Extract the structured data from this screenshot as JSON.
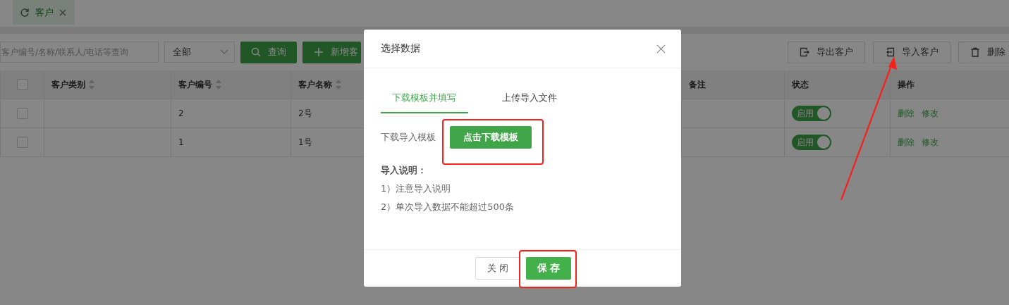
{
  "tab": {
    "label": "客户",
    "selected": true
  },
  "toolbar": {
    "search": {
      "placeholder": "客户编号/名称/联系人/电话等查询"
    },
    "filter": {
      "value": "全部"
    },
    "query_button": "查询",
    "add_button": "新增客",
    "actions": [
      {
        "kind": "export",
        "label": "导出客户"
      },
      {
        "kind": "import",
        "label": "导入客户"
      },
      {
        "kind": "delete",
        "label": "删除"
      }
    ]
  },
  "table": {
    "header_checked": false,
    "columns": [
      {
        "label": "客户类别",
        "sortable": true
      },
      {
        "label": "客户编号",
        "sortable": true
      },
      {
        "label": "客户名称",
        "sortable": true
      },
      {
        "label": "备注",
        "sortable": false
      },
      {
        "label": "状态",
        "sortable": false
      },
      {
        "label": "操作",
        "sortable": false
      }
    ],
    "rows": [
      {
        "checked": false,
        "code": "2",
        "name": "2号",
        "status": {
          "label": "启用",
          "on": true
        },
        "actions": [
          "删除",
          "修改"
        ]
      },
      {
        "checked": false,
        "code": "1",
        "name": "1号",
        "status": {
          "label": "启用",
          "on": true
        },
        "actions": [
          "删除",
          "修改"
        ]
      }
    ]
  },
  "dialog": {
    "title": "选择数据",
    "tabs": [
      {
        "label": "下载模板并填写",
        "selected": true
      },
      {
        "label": "上传导入文件",
        "selected": false
      }
    ],
    "download_label": "下载导入模板",
    "download_button": "点击下载模板",
    "notes_title": "导入说明：",
    "notes": [
      "1）注意导入说明",
      "2）单次导入数据不能超过500条"
    ],
    "close_button": "关 闭",
    "save_button": "保 存"
  }
}
